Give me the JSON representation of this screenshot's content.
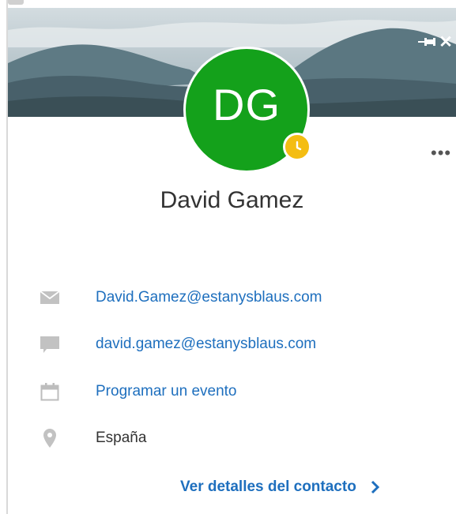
{
  "window": {
    "pin_label": "Anclar",
    "close_label": "Cerrar"
  },
  "banner": {
    "image": "mountain-landscape"
  },
  "contact": {
    "initials": "DG",
    "name": "David Gamez",
    "presence": "away-clock",
    "avatar_color": "#14a11b",
    "presence_color": "#f4bd12"
  },
  "more_label": "•••",
  "details": [
    {
      "icon": "mail-icon",
      "text": "David.Gamez@estanysblaus.com",
      "link": true
    },
    {
      "icon": "chat-icon",
      "text": "david.gamez@estanysblaus.com",
      "link": true
    },
    {
      "icon": "calendar-icon",
      "text": "Programar un evento",
      "link": true
    },
    {
      "icon": "location-pin-icon",
      "text": "España",
      "link": false
    }
  ],
  "footer": {
    "contact_details_label": "Ver detalles del contacto"
  },
  "colors": {
    "link": "#1e6fbe",
    "text": "#333333",
    "icon": "#c2c2c2"
  }
}
